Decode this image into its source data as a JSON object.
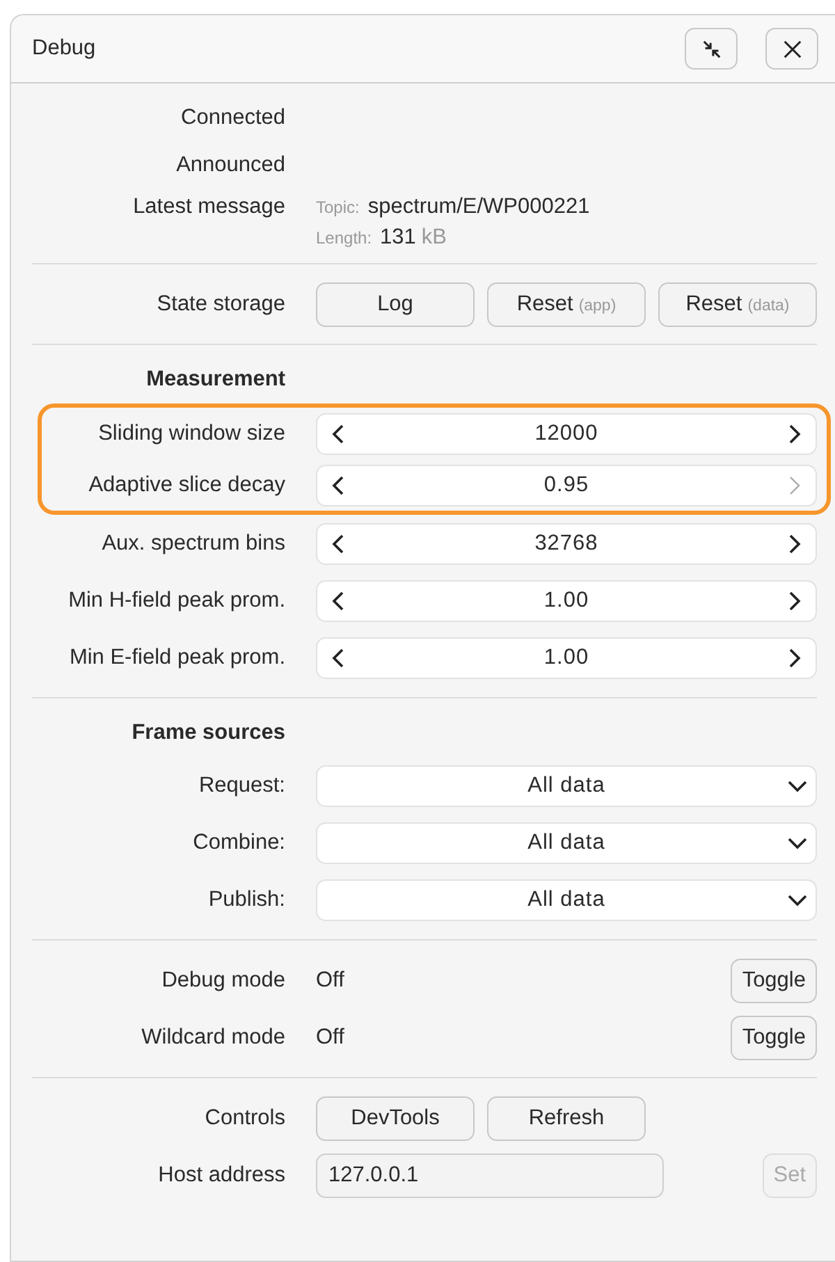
{
  "window": {
    "title": "Debug"
  },
  "header_buttons": [
    {
      "kind": "collapse"
    },
    {
      "kind": "close"
    }
  ],
  "status": [
    {
      "label": "Connected"
    },
    {
      "label": "Announced"
    }
  ],
  "latest_message": {
    "label": "Latest message",
    "fields": [
      {
        "key": "Topic:",
        "value": "spectrum/E/WP000221"
      },
      {
        "key": "Length:",
        "value": "131",
        "unit": "kB"
      }
    ]
  },
  "state_storage": {
    "label": "State storage",
    "buttons": [
      {
        "label": "Log"
      },
      {
        "label": "Reset",
        "note": "(app)"
      },
      {
        "label": "Reset",
        "note": "(data)"
      }
    ]
  },
  "measurement": {
    "title": "Measurement",
    "steppers": [
      {
        "label": "Sliding window size",
        "value": "12000",
        "highlighted": true,
        "next_disabled": false
      },
      {
        "label": "Adaptive slice decay",
        "value": "0.95",
        "highlighted": true,
        "next_disabled": true
      },
      {
        "label": "Aux. spectrum bins",
        "value": "32768",
        "highlighted": false,
        "next_disabled": false
      },
      {
        "label": "Min H-field peak prom.",
        "value": "1.00",
        "highlighted": false,
        "next_disabled": false
      },
      {
        "label": "Min E-field peak prom.",
        "value": "1.00",
        "highlighted": false,
        "next_disabled": false
      }
    ]
  },
  "frame_sources": {
    "title": "Frame sources",
    "selects": [
      {
        "label": "Request:",
        "value": "All data"
      },
      {
        "label": "Combine:",
        "value": "All data"
      },
      {
        "label": "Publish:",
        "value": "All data"
      }
    ]
  },
  "modes": [
    {
      "label": "Debug mode",
      "value": "Off",
      "button": "Toggle"
    },
    {
      "label": "Wildcard mode",
      "value": "Off",
      "button": "Toggle"
    }
  ],
  "controls": {
    "label": "Controls",
    "buttons": [
      "DevTools",
      "Refresh"
    ]
  },
  "host": {
    "label": "Host address",
    "value": "127.0.0.1",
    "button": {
      "label": "Set",
      "disabled": true
    }
  }
}
